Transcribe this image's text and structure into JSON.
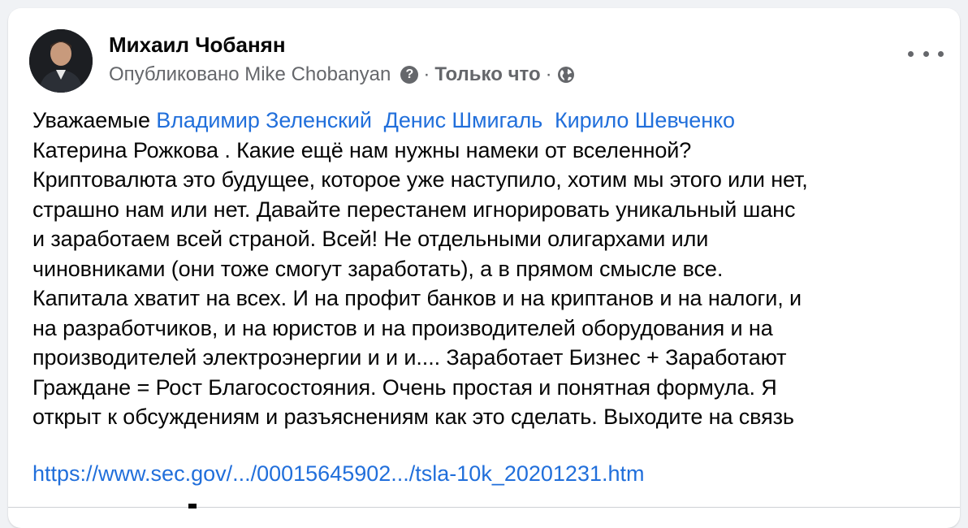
{
  "post": {
    "author": "Михаил Чобанян",
    "published_by": "Опубликовано Mike Chobanyan",
    "help_icon": "question-mark-icon",
    "separator": "·",
    "time": "Только что",
    "audience_icon": "globe-icon",
    "more_icon": "more-options-icon",
    "body": {
      "line1": {
        "prefix": "Уважаемые ",
        "mentions": [
          "Владимир Зеленский",
          "Денис Шмигаль",
          "Кирило Шевченко"
        ]
      },
      "line2": "Катерина Рожкова  . Какие ещё нам нужны намеки от вселенной?",
      "line3": "Криптовалюта это будущее, которое уже наступило, хотим мы этого или нет,",
      "line4": "страшно нам или нет.  Давайте перестанем игнорировать уникальный шанс",
      "line5": "и  заработаем всей страной. Всей! Не отдельными олигархами или",
      "line6": "чиновниками (они тоже смогут заработать), а в прямом смысле все.",
      "line7": "Капитала хватит на всех. И на профит банков и на криптанов и на налоги, и",
      "line8": "на разработчиков, и на юристов и на производителей оборудования и на",
      "line9": "производителей электроэнергии и и и.... Заработает Бизнес + Заработают",
      "line10": "Граждане = Рост Благосостояния. Очень простая и понятная формула. Я",
      "line11": "открыт к обсуждениям и разъяснениям как это сделать. Выходите на связь"
    },
    "link": "https://www.sec.gov/.../00015645902.../tsla-10k_20201231.htm"
  }
}
